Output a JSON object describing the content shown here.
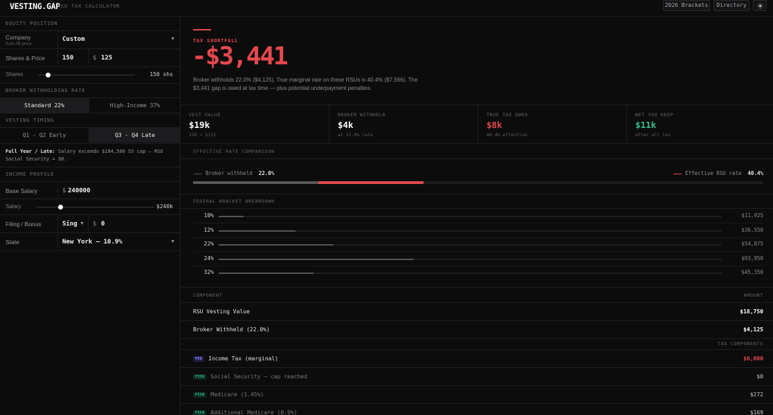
{
  "app": {
    "brand": "VESTING.GAP",
    "subtitle": "RSU TAX CALCULATOR",
    "brackets_button": "2026 Brackets",
    "directory_button": "Directory",
    "theme_icon": "sun-icon"
  },
  "sidebar": {
    "equity_header": "EQUITY POSITION",
    "company_label": "Company",
    "company_sub": "Auto-fill price",
    "company_value": "Custom",
    "shares_price_label": "Shares & Price",
    "shares_value": "150",
    "currency_symbol": "$",
    "price_value": "125",
    "shares_slider_label": "Shares",
    "shares_slider_value": "150 shs",
    "shares_slider_level": 0.1,
    "withholding_header": "BROKER WITHHOLDING RATE",
    "withholding_options": [
      "Standard 22%",
      "High-Income 37%"
    ],
    "withholding_selected": 0,
    "timing_header": "VESTING TIMING",
    "timing_options": [
      "Q1 - Q2 Early",
      "Q3 - Q4 Late"
    ],
    "timing_selected": 1,
    "timing_note_bold": "Full Year / Late:",
    "timing_note": "Salary exceeds $184,500 SS cap — RSU Social Security = $0.",
    "income_header": "INCOME PROFILE",
    "base_salary_label": "Base Salary",
    "base_salary_value": "240000",
    "salary_slider_label": "Salary",
    "salary_slider_value": "$240k",
    "salary_slider_level": 0.2,
    "filing_label": "Filing / Bonus",
    "filing_value": "Sing",
    "bonus_value": "0",
    "state_label": "State",
    "state_value": "New York — 10.9%"
  },
  "shortfall": {
    "label": "TAX SHORTFALL",
    "amount": "-$3,441",
    "description": "Broker withholds 22.0% ($4,125). True marginal rate on these RSUs is 40.4% ($7,566). The $3,441 gap is owed at tax time — plus potential underpayment penalties."
  },
  "stats": [
    {
      "label": "VEST VALUE",
      "value": "$19k",
      "sub": "150 × $125",
      "color": "#ffffff"
    },
    {
      "label": "BROKER WITHHELD",
      "value": "$4k",
      "sub": "at 22.0% rate",
      "color": "#ffffff"
    },
    {
      "label": "TRUE TAX OWED",
      "value": "$8k",
      "sub": "40.4% effective",
      "color": "#e5484d"
    },
    {
      "label": "NET YOU KEEP",
      "value": "$11k",
      "sub": "after all tax",
      "color": "#30c48d"
    }
  ],
  "rate_comparison": {
    "header": "EFFECTIVE RATE COMPARISON",
    "broker_label": "Broker withheld",
    "broker_value": "22.0%",
    "effective_label": "Effective RSU rate",
    "effective_value": "40.4%",
    "broker_fraction": 0.22,
    "effective_fraction": 0.404,
    "broker_color": "#5a5a5c",
    "effective_color": "#e5484d"
  },
  "brackets": {
    "header": "FEDERAL BRACKET BREAKDOWN",
    "rows": [
      {
        "rate": "10%",
        "amount": "$11,925",
        "fill": 0.05
      },
      {
        "rate": "12%",
        "amount": "$36,550",
        "fill": 0.152
      },
      {
        "rate": "22%",
        "amount": "$54,875",
        "fill": 0.228
      },
      {
        "rate": "24%",
        "amount": "$93,950",
        "fill": 0.388
      },
      {
        "rate": "32%",
        "amount": "$45,350",
        "fill": 0.188
      }
    ]
  },
  "components": {
    "col_component": "COMPONENT",
    "col_amount": "AMOUNT",
    "rsu_label": "RSU Vesting Value",
    "rsu_amount": "$18,750",
    "withheld_label": "Broker Withheld (22.0%)",
    "withheld_amount": "$4,125",
    "tax_components_header": "TAX COMPONENTS",
    "items": [
      {
        "tag": "FED",
        "label": "Income Tax (marginal)",
        "amount": "$6,000",
        "muted": false
      },
      {
        "tag": "FICA",
        "label": "Social Security — cap reached",
        "amount": "$0",
        "muted": true
      },
      {
        "tag": "FICA",
        "label": "Medicare (1.45%)",
        "amount": "$272",
        "muted": true
      },
      {
        "tag": "FICA",
        "label": "Additional Medicare (0.9%)",
        "amount": "$169",
        "muted": true
      }
    ]
  }
}
